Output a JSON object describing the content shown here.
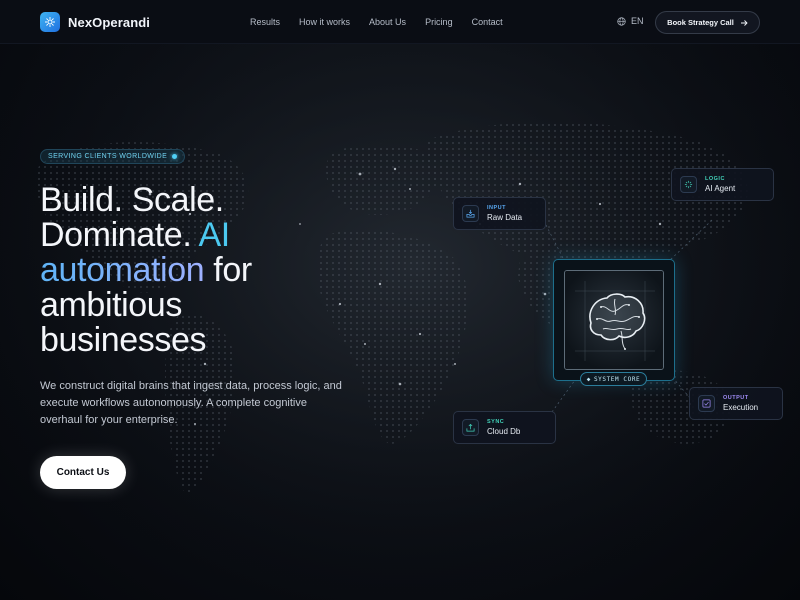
{
  "brand": {
    "name": "NexOperandi",
    "accent": "#4cc9f0"
  },
  "nav": {
    "links": [
      "Results",
      "How it works",
      "About Us",
      "Pricing",
      "Contact"
    ],
    "language": "EN",
    "cta_label": "Book Strategy Call"
  },
  "hero": {
    "badge": "SERVING CLIENTS WORLDWIDE",
    "headline": {
      "line1": "Build. Scale.",
      "line2_a": "Dominate.",
      "line2_b": "AI",
      "line3_a": "automation",
      "line3_b": "for",
      "line4": "ambitious",
      "line5": "businesses"
    },
    "subtext": "We construct digital brains that ingest data, process logic, and execute workflows autonomously. A complete cognitive overhaul for your enterprise.",
    "cta_label": "Contact Us"
  },
  "diagram": {
    "core_label": "SYSTEM CORE",
    "nodes": {
      "input": {
        "kicker": "INPUT",
        "title": "Raw Data",
        "icon": "inbox-icon"
      },
      "logic": {
        "kicker": "LOGIC",
        "title": "AI Agent",
        "icon": "spark-icon"
      },
      "sync": {
        "kicker": "SYNC",
        "title": "Cloud Db",
        "icon": "upload-icon"
      },
      "output": {
        "kicker": "OUTPUT",
        "title": "Execution",
        "icon": "check-icon"
      }
    }
  }
}
